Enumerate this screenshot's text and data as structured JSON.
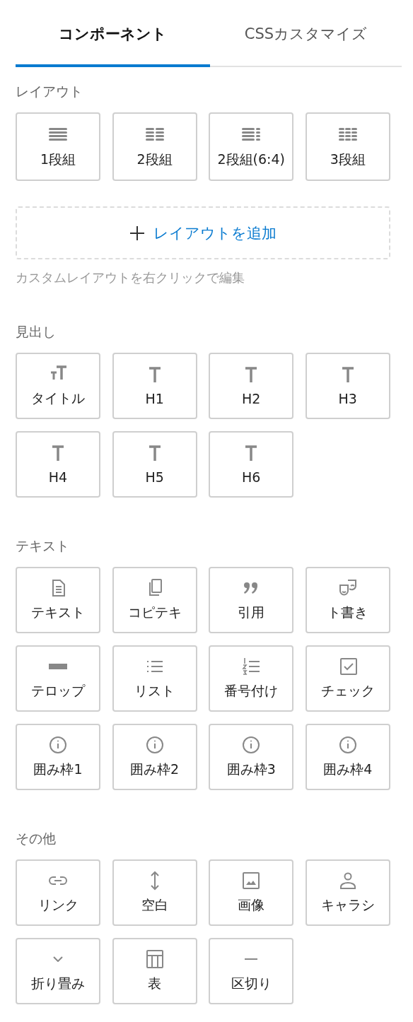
{
  "tabs": [
    {
      "label": "コンポーネント",
      "selected": true
    },
    {
      "label": "CSSカスタマイズ",
      "selected": false
    }
  ],
  "sections": [
    {
      "heading": "レイアウト",
      "kind": "layout",
      "items": [
        "1段組",
        "2段組",
        "2段組(6:4)",
        "3段組"
      ],
      "add_button": "レイアウトを追加",
      "hint": "カスタムレイアウトを右クリックで編集"
    },
    {
      "heading": "見出し",
      "kind": "plain",
      "items": [
        "タイトル",
        "H1",
        "H2",
        "H3",
        "H4",
        "H5",
        "H6"
      ]
    },
    {
      "heading": "テキスト",
      "kind": "plain",
      "items": [
        "テキスト",
        "コピテキ",
        "引用",
        "ト書き",
        "テロップ",
        "リスト",
        "番号付け",
        "チェック",
        "囲み枠1",
        "囲み枠2",
        "囲み枠3",
        "囲み枠4"
      ]
    },
    {
      "heading": "その他",
      "kind": "plain",
      "items": [
        "リンク",
        "空白",
        "画像",
        "キャラシ",
        "折り畳み",
        "表",
        "区切り"
      ]
    }
  ]
}
